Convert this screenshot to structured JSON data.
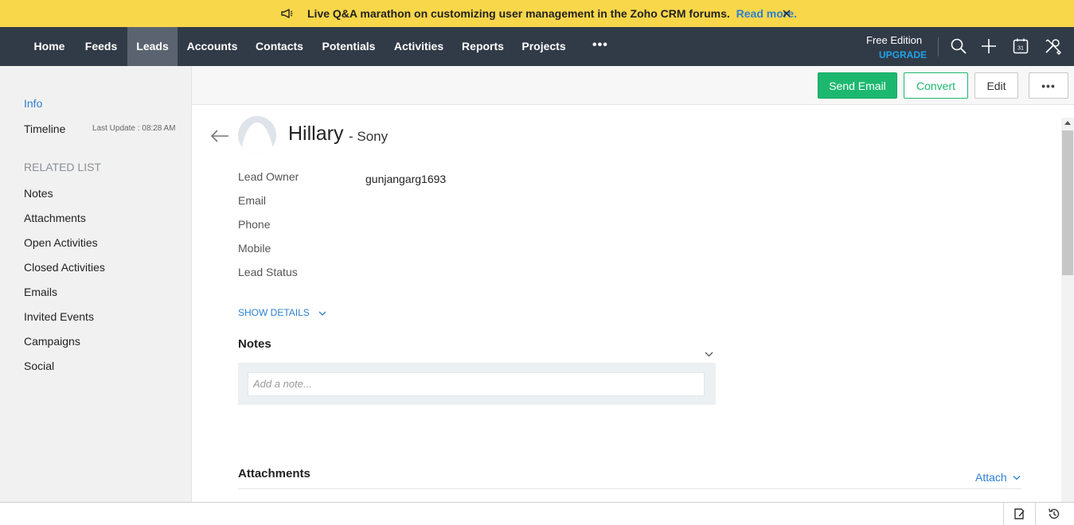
{
  "announcement": {
    "message": "Live Q&A marathon on customizing user management in the Zoho CRM forums.",
    "link": "Read more.",
    "close_icon": "close-icon",
    "megaphone_icon": "megaphone-icon"
  },
  "nav": {
    "items": [
      {
        "label": "Home"
      },
      {
        "label": "Feeds"
      },
      {
        "label": "Leads",
        "active": true
      },
      {
        "label": "Accounts"
      },
      {
        "label": "Contacts"
      },
      {
        "label": "Potentials"
      },
      {
        "label": "Activities"
      },
      {
        "label": "Reports"
      },
      {
        "label": "Projects"
      }
    ],
    "more": "•••",
    "edition": "Free Edition",
    "upgrade": "UPGRADE",
    "icons": [
      "search-icon",
      "plus-icon",
      "calendar-icon",
      "setup-tools-icon"
    ],
    "calendar_day": "31"
  },
  "sidebar": {
    "info": "Info",
    "timeline": "Timeline",
    "last_update": "Last Update : 08:28 AM",
    "related_heading": "RELATED LIST",
    "related": [
      "Notes",
      "Attachments",
      "Open Activities",
      "Closed Activities",
      "Emails",
      "Invited Events",
      "Campaigns",
      "Social"
    ]
  },
  "toolbar": {
    "send_email": "Send Email",
    "convert": "Convert",
    "edit": "Edit",
    "more": "•••"
  },
  "lead": {
    "name": "Hillary",
    "company": "- Sony",
    "fields": [
      {
        "label": "Lead Owner",
        "value": "gunjangarg1693"
      },
      {
        "label": "Email",
        "value": ""
      },
      {
        "label": "Phone",
        "value": ""
      },
      {
        "label": "Mobile",
        "value": ""
      },
      {
        "label": "Lead Status",
        "value": ""
      }
    ],
    "show_details": "SHOW DETAILS"
  },
  "notes": {
    "title": "Notes",
    "placeholder": "Add a note..."
  },
  "attachments": {
    "title": "Attachments",
    "attach": "Attach"
  },
  "colors": {
    "announce_bg": "#f9d74a",
    "nav_bg": "#313a47",
    "nav_active": "#5b6370",
    "accent_blue": "#2d7fd3",
    "green": "#1db86f"
  }
}
